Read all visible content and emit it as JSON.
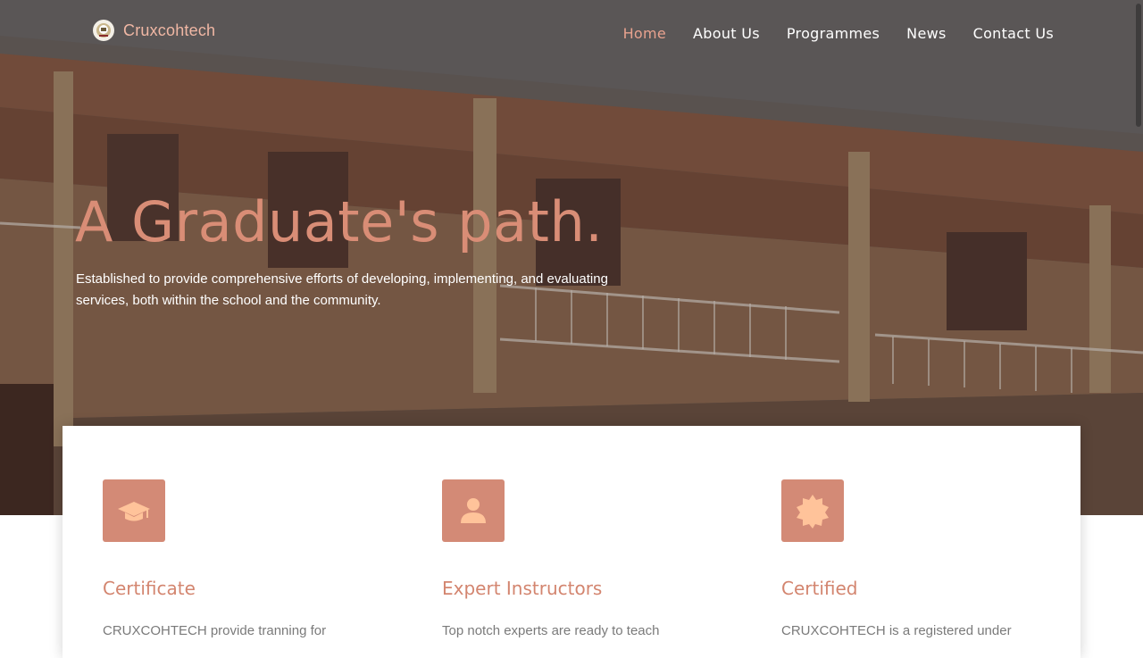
{
  "brand": {
    "name": "Cruxcohtech",
    "logo_icon": "school-crest-icon"
  },
  "nav": {
    "items": [
      {
        "label": "Home",
        "active": true
      },
      {
        "label": "About Us",
        "active": false
      },
      {
        "label": "Programmes",
        "active": false
      },
      {
        "label": "News",
        "active": false
      },
      {
        "label": "Contact Us",
        "active": false
      }
    ]
  },
  "hero": {
    "title": "A Graduate's path.",
    "subtitle": "Established to provide comprehensive efforts of developing, implementing, and evaluating services, both within the school and the community.",
    "background": "school-building-photo"
  },
  "features": [
    {
      "icon": "graduation-cap-icon",
      "title": "Certificate",
      "text": "CRUXCOHTECH provide tranning for"
    },
    {
      "icon": "user-icon",
      "title": "Expert Instructors",
      "text": "Top notch experts are ready to teach"
    },
    {
      "icon": "certified-badge-icon",
      "title": "Certified",
      "text": "CRUXCOHTECH is a registered under"
    }
  ],
  "colors": {
    "accent": "#d38a76",
    "nav_active": "#e8a28e",
    "icon_glyph": "#ffc39a"
  }
}
